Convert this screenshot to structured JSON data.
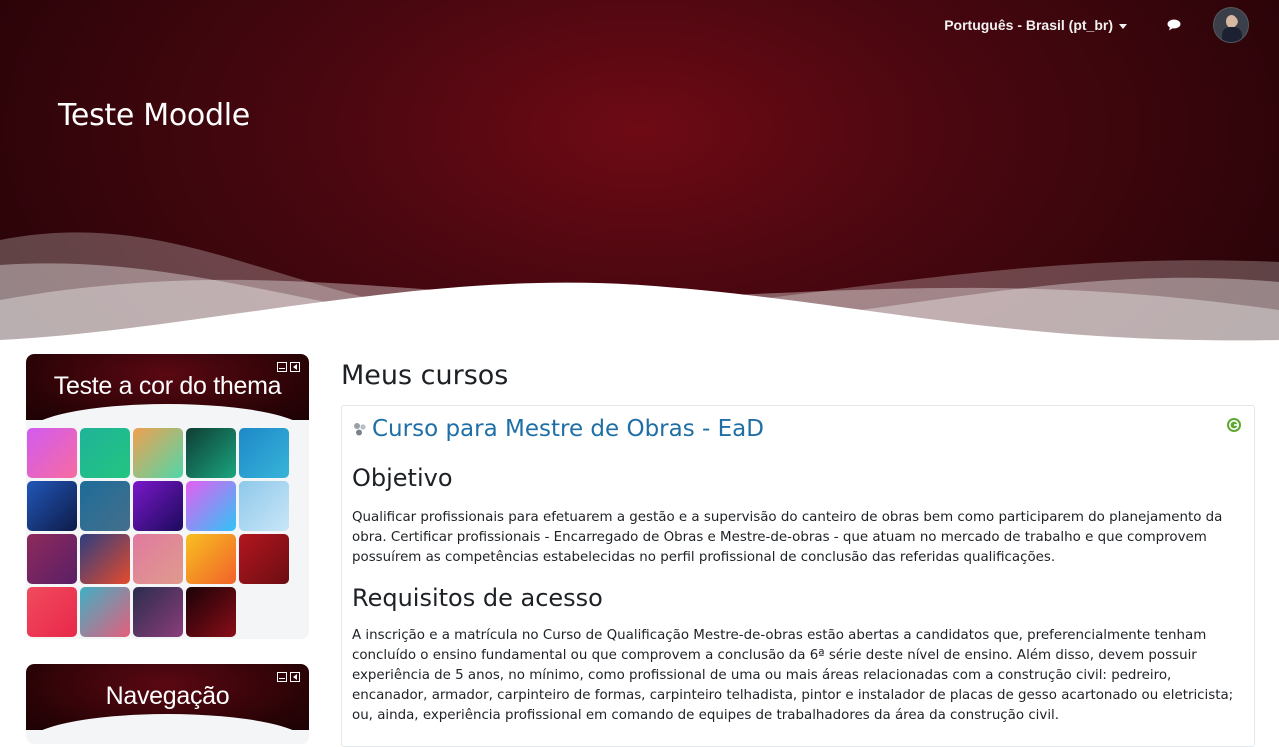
{
  "header": {
    "site_title": "Teste Moodle",
    "language_menu": "Português - Brasil (pt_br)",
    "messages_icon": "message-bubble-icon",
    "user_avatar": "user-avatar"
  },
  "theme_block": {
    "title": "Teste a cor do thema",
    "controls": [
      "collapse-icon",
      "dock-icon"
    ],
    "swatches": [
      {
        "from": "#d15bf0",
        "to": "#f76ba1"
      },
      {
        "from": "#1fb39a",
        "to": "#23c47f"
      },
      {
        "from": "#f0a04f",
        "to": "#4fd7a9"
      },
      {
        "from": "#0f3d34",
        "to": "#1aa57f"
      },
      {
        "from": "#1e88c8",
        "to": "#37b4d9"
      },
      {
        "from": "#2257b8",
        "to": "#0d1b48"
      },
      {
        "from": "#1d6d99",
        "to": "#456e8c"
      },
      {
        "from": "#7a18c9",
        "to": "#1b0a5c"
      },
      {
        "from": "#e55ef2",
        "to": "#2fc4f5"
      },
      {
        "from": "#8ec8ea",
        "to": "#c9e6f7"
      },
      {
        "from": "#8e2a5c",
        "to": "#5a1f66"
      },
      {
        "from": "#2c3e80",
        "to": "#e54b2c"
      },
      {
        "from": "#e07aa0",
        "to": "#e09a8c"
      },
      {
        "from": "#f7c021",
        "to": "#f2612a"
      },
      {
        "from": "#b3161f",
        "to": "#6b0d12"
      },
      {
        "from": "#f04b5e",
        "to": "#e8284a"
      },
      {
        "from": "#3fb0c4",
        "to": "#e55e7c"
      },
      {
        "from": "#2b2d4e",
        "to": "#8a3d7a"
      },
      {
        "from": "#1a0206",
        "to": "#8a0d18"
      }
    ]
  },
  "nav_block": {
    "title": "Navegação",
    "controls": [
      "collapse-icon",
      "dock-icon"
    ]
  },
  "main": {
    "title": "Meus cursos",
    "course": {
      "name": "Curso para Mestre de Obras - EaD",
      "sections": [
        {
          "heading": "Objetivo",
          "text": "Qualificar profissionais para efetuarem a gestão e a supervisão do canteiro de obras  bem como participarem do planejamento da obra. Certificar profissionais - Encarregado de Obras e Mestre-de-obras - que atuam no mercado de trabalho e que comprovem possuírem as competências estabelecidas no perfil profissional de conclusão das referidas qualificações."
        },
        {
          "heading": "Requisitos de acesso",
          "text": "A inscrição e a matrícula no Curso de Qualificação Mestre-de-obras estão abertas a candidatos que, preferencialmente tenham concluído o ensino fundamental ou que comprovem a conclusão da 6ª série deste nível de ensino. Além disso, devem possuir experiência de 5 anos, no mínimo, como profissional de uma ou mais áreas relacionadas com a construção civil: pedreiro, encanador, armador, carpinteiro de formas, carpinteiro telhadista, pintor e instalador de placas de gesso acartonado ou eletricista; ou, ainda, experiência profissional em comando de equipes de trabalhadores da área da construção civil."
        }
      ]
    }
  }
}
